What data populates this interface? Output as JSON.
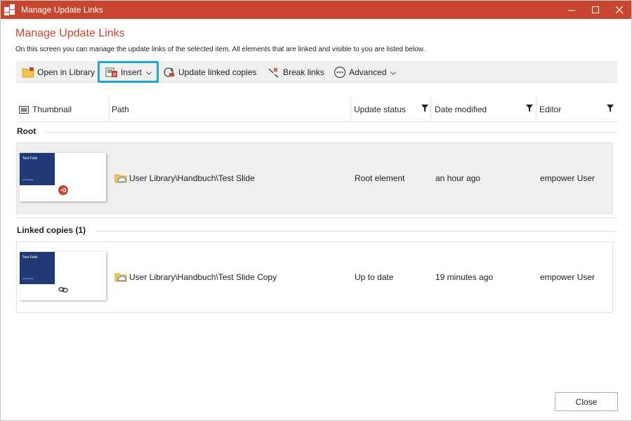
{
  "window": {
    "title": "Manage Update Links",
    "title_bar_color": "#c8452f"
  },
  "header": {
    "heading": "Manage Update Links",
    "description": "On this screen you can manage the update links of the selected item. All elements that are linked and visible to you are listed below."
  },
  "toolbar": {
    "open_in_library": "Open in Library",
    "insert": "Insert",
    "update_linked_copies": "Update linked copies",
    "break_links": "Break links",
    "advanced": "Advanced",
    "highlight_color": "#1ea7d6"
  },
  "columns": {
    "thumbnail": "Thumbnail",
    "path": "Path",
    "update_status": "Update status",
    "date_modified": "Date modified",
    "editor": "Editor"
  },
  "groups": {
    "root": {
      "label": "Root",
      "rows": [
        {
          "thumb_title": "Test Folie",
          "thumb_sub": "Änderungen",
          "path": "User Library\\Handbuch\\Test Slide",
          "status": "Root element",
          "date": "an hour ago",
          "editor": "empower User"
        }
      ]
    },
    "linked": {
      "label": "Linked copies (1)",
      "rows": [
        {
          "thumb_title": "Test Folie",
          "thumb_sub": "Änderungen",
          "path": "User Library\\Handbuch\\Test Slide Copy",
          "status": "Up to date",
          "date": "19 minutes ago",
          "editor": "empower User"
        }
      ]
    }
  },
  "footer": {
    "close": "Close"
  }
}
